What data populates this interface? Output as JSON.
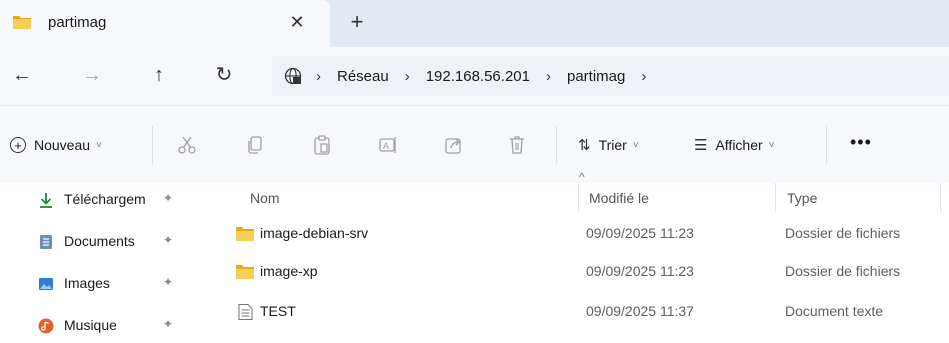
{
  "tab": {
    "title": "partimag",
    "close_glyph": "✕",
    "new_tab_glyph": "+"
  },
  "nav": {
    "back": "←",
    "forward": "→",
    "up": "↑",
    "refresh": "↻"
  },
  "breadcrumb": {
    "separator": "›",
    "items": [
      "Réseau",
      "192.168.56.201",
      "partimag"
    ]
  },
  "toolbar": {
    "new_label": "Nouveau",
    "sort_label": "Trier",
    "view_label": "Afficher",
    "more_label": "•••",
    "chevron": "˅"
  },
  "sidebar": {
    "items": [
      {
        "label": "Téléchargem",
        "icon": "download-icon"
      },
      {
        "label": "Documents",
        "icon": "documents-icon"
      },
      {
        "label": "Images",
        "icon": "images-icon"
      },
      {
        "label": "Musique",
        "icon": "music-icon"
      }
    ],
    "pin_glyph": "📌"
  },
  "columns": {
    "name": "Nom",
    "modified": "Modifié le",
    "type": "Type",
    "sort_caret": "^"
  },
  "files": [
    {
      "name": "image-debian-srv",
      "modified": "09/09/2025 11:23",
      "type": "Dossier de fichiers",
      "icon": "folder-icon"
    },
    {
      "name": "image-xp",
      "modified": "09/09/2025 11:23",
      "type": "Dossier de fichiers",
      "icon": "folder-icon"
    },
    {
      "name": "TEST",
      "modified": "09/09/2025 11:37",
      "type": "Document texte",
      "icon": "text-file-icon"
    }
  ],
  "colors": {
    "folder": "#f5c24a",
    "accent": "#0067c0",
    "chrome": "#f6f8fb"
  }
}
